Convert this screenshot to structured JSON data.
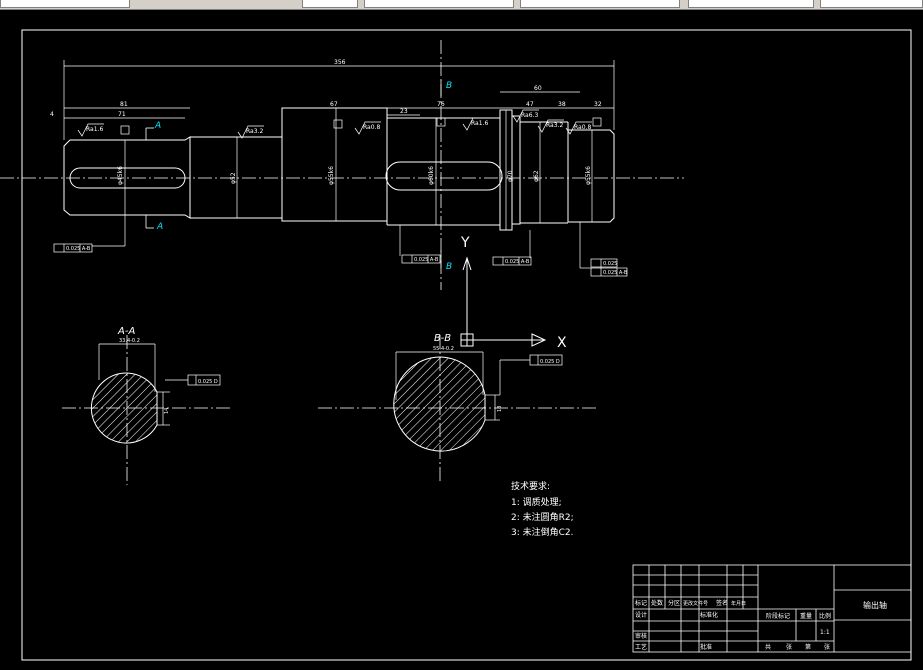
{
  "toolbar": {
    "items": [
      "",
      "",
      "",
      "",
      "",
      ""
    ]
  },
  "drawing": {
    "dims": {
      "overall": "356",
      "d_81": "81",
      "d_71": "71",
      "d_4": "4",
      "d_67": "67",
      "d_76": "76",
      "d_23": "23",
      "d_60": "60",
      "d_47": "47",
      "d_38": "38",
      "d_32": "32",
      "dia_first": "φ45k6",
      "dia_second": "φ52",
      "dia_third": "φ55k6",
      "dia_fourth": "φ60k6",
      "dia_fifth": "φ70",
      "dia_sixth": "φ62",
      "dia_seventh": "φ55k6"
    },
    "rough": {
      "r1": "Ra1.6",
      "r2": "Ra3.2",
      "r3": "Ra0.8",
      "r4": "Ra1.6",
      "r5": "Ra6.3",
      "r6": "Ra3.2",
      "r7": "Ra0.8"
    },
    "datum": {
      "a_top": "A",
      "a_bottom": "A",
      "b_top": "B",
      "b_bottom": "B",
      "datum_box": "A"
    },
    "axis": {
      "y": "Y",
      "x": "X"
    },
    "tol": {
      "t1": "0.025  A-B",
      "t2": "0.025  A-B",
      "t3": "0.025  A-B",
      "t4": "0.025",
      "t5": "0.025  A-B",
      "keyway1": "0.025  D",
      "keyway2": "0.025  D"
    },
    "section_aa": {
      "title": "A-A",
      "dim_top": "33.4-0.2",
      "dim_side": "14"
    },
    "section_bb": {
      "title": "B-B",
      "dim_top": "55.4-0.2",
      "dim_side": "18"
    },
    "notes": {
      "title": "技术要求:",
      "line1": "1: 调质处理;",
      "line2": "2: 未注圆角R2;",
      "line3": "3: 未注倒角C2."
    },
    "title_block": {
      "part_name": "输出轴",
      "scale": "1:1",
      "col_labels": [
        "标记",
        "处数",
        "分区",
        "更改文件号",
        "签名",
        "年月日"
      ],
      "design": "设计",
      "standard": "标准化",
      "check": "审核",
      "process": "工艺",
      "approve": "批准",
      "stage": "阶段标记",
      "weight": "重量",
      "ratio": "比例",
      "sheets": [
        "共",
        "张",
        "第",
        "张"
      ]
    }
  },
  "colors": {
    "line": "#ffffff",
    "accent": "#00e5ff",
    "background": "#000000"
  }
}
